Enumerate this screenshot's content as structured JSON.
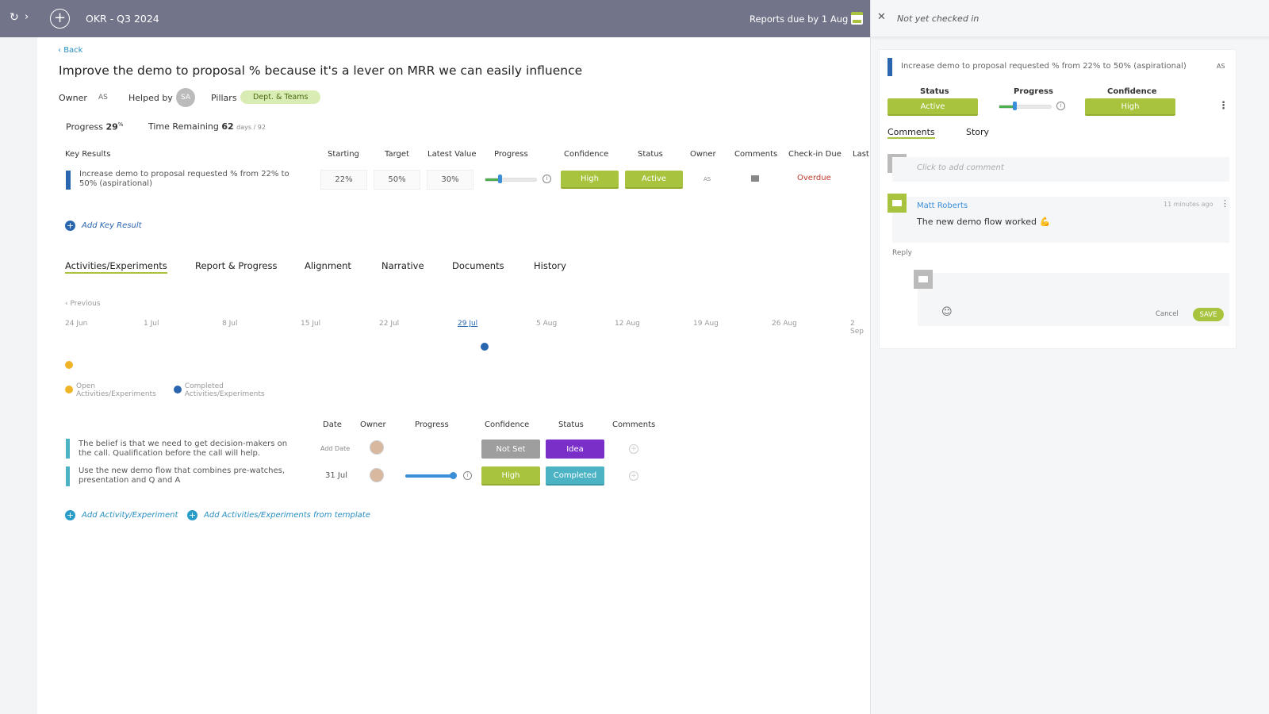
{
  "topbar": {
    "title": "OKR - Q3 2024",
    "reports_due": "Reports due by 1 Aug",
    "icons": [
      "refresh-icon",
      "chevron-right-icon",
      "plus-circle-icon",
      "calendar-icon"
    ]
  },
  "main": {
    "back": "Back",
    "objective": "Improve the demo to proposal % because it's a lever on MRR we can easily influence",
    "owner_label": "Owner",
    "owner": "AS",
    "helped_label": "Helped by",
    "helper": "SA",
    "pillars_label": "Pillars",
    "pillar": "Dept. & Teams",
    "progress_label": "Progress",
    "progress": "29",
    "progress_unit": "%",
    "time_label": "Time Remaining",
    "time_value": "62",
    "time_unit": "days / 92",
    "kr_headers": [
      "Key Results",
      "Starting",
      "Target",
      "Latest Value",
      "Progress",
      "Confidence",
      "Status",
      "Owner",
      "Comments",
      "Check-in Due",
      "Last"
    ],
    "key_result": {
      "name": "Increase demo to proposal requested % from 22% to 50% (aspirational)",
      "starting": "22%",
      "target": "50%",
      "latest": "30%",
      "progress_pct": 29,
      "confidence": "High",
      "status": "Active",
      "owner": "AS",
      "checkin": "Overdue"
    },
    "add_kr": "Add Key Result",
    "tabs": [
      "Activities/Experiments",
      "Report & Progress",
      "Alignment",
      "Narrative",
      "Documents",
      "History"
    ],
    "previous": "Previous",
    "timeline_dates": [
      "24 Jun",
      "1 Jul",
      "8 Jul",
      "15 Jul",
      "22 Jul",
      "29 Jul",
      "5 Aug",
      "12 Aug",
      "19 Aug",
      "26 Aug",
      "2 Sep"
    ],
    "legend": [
      {
        "label1": "Open",
        "label2": "Activities/Experiments",
        "color": "#f0b429"
      },
      {
        "label1": "Completed",
        "label2": "Activities/Experiments",
        "color": "#2a66b0"
      }
    ],
    "act_headers": [
      "Date",
      "Owner",
      "Progress",
      "Confidence",
      "Status",
      "Comments"
    ],
    "activities": [
      {
        "name": "The belief is that we need to get decision-makers on the call. Qualification before the call will help.",
        "date": "Add Date",
        "confidence": "Not Set",
        "status": "Idea"
      },
      {
        "name": "Use the new demo flow that combines pre-watches, presentation and Q and A",
        "date": "31 Jul",
        "progress_pct": 100,
        "confidence": "High",
        "status": "Completed"
      }
    ],
    "add_activity": "Add Activity/Experiment",
    "add_template": "Add Activities/Experiments from template"
  },
  "panel": {
    "header": "Not yet checked in",
    "kr": "Increase demo to proposal requested % from 22% to 50% (aspirational)",
    "owner": "AS",
    "status_label": "Status",
    "status": "Active",
    "progress_label": "Progress",
    "progress_pct": 29,
    "confidence_label": "Confidence",
    "confidence": "High",
    "tabs": [
      "Comments",
      "Story"
    ],
    "comment_placeholder": "Click to add comment",
    "comment": {
      "author": "Matt Roberts",
      "time": "11 minutes ago",
      "text": "The new demo flow worked 💪"
    },
    "reply": "Reply",
    "cancel": "Cancel",
    "save": "SAVE"
  },
  "colors": {
    "accent": "#a8c43f",
    "header": "#727489",
    "purple": "#7b2fc9",
    "teal": "#4bb3c4",
    "overdue": "#c0392b"
  }
}
